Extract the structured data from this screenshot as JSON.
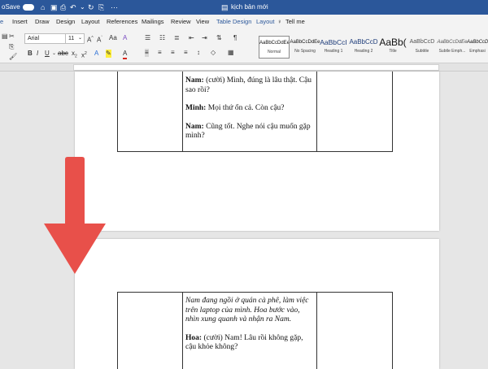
{
  "titlebar": {
    "autosave": "oSave",
    "doc_title": "kịch bản mới"
  },
  "tabs": [
    "e",
    "Insert",
    "Draw",
    "Design",
    "Layout",
    "References",
    "Mailings",
    "Review",
    "View",
    "Table Design",
    "Layout",
    "Tell me"
  ],
  "ribbon": {
    "font_name": "Arial",
    "font_size": "11",
    "styles": [
      {
        "preview": "AaBbCcDdEe",
        "name": "Normal"
      },
      {
        "preview": "AaBbCcDdEe",
        "name": "No Spacing"
      },
      {
        "preview": "AaBbCcI",
        "name": "Heading 1"
      },
      {
        "preview": "AaBbCcD",
        "name": "Heading 2"
      },
      {
        "preview": "AaBb(",
        "name": "Title"
      },
      {
        "preview": "AaBbCcD",
        "name": "Subtitle"
      },
      {
        "preview": "AaBbCcDdEe",
        "name": "Subtle Emph..."
      },
      {
        "preview": "AaBbCcD",
        "name": "Emphasi"
      }
    ]
  },
  "document": {
    "page1": {
      "l1_speaker": "Nam:",
      "l1_text": "(cười) Mình, đúng là lâu thật. Cậu sao rồi?",
      "l2_speaker": "Minh:",
      "l2_text": "Mọi thứ ổn cả. Còn cậu?",
      "l3_speaker": "Nam:",
      "l3_text": "Cũng tốt. Nghe nói cậu muốn gặp mình?"
    },
    "page2": {
      "narration": "Nam đang ngồi ở quán cà phê, làm việc trên laptop của mình. Hoa bước vào, nhìn xung quanh và nhận ra Nam.",
      "l1_speaker": "Hoa:",
      "l1_text": "(cười) Nam! Lâu rồi không gặp, cậu khỏe không?"
    }
  },
  "colors": {
    "titlebar": "#2b579a",
    "arrow": "#e8504a"
  }
}
